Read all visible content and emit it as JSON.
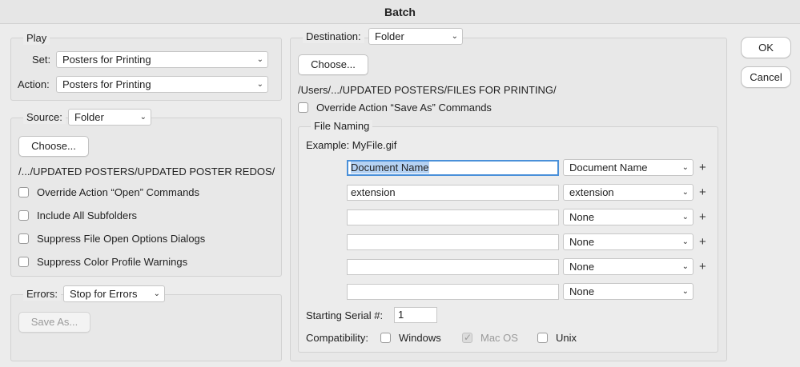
{
  "window": {
    "title": "Batch"
  },
  "play": {
    "legend": "Play",
    "set_label": "Set:",
    "set_value": "Posters for Printing",
    "action_label": "Action:",
    "action_value": "Posters for Printing"
  },
  "source": {
    "label": "Source:",
    "value": "Folder",
    "choose_label": "Choose...",
    "path": "/.../UPDATED POSTERS/UPDATED POSTER REDOS/",
    "options": [
      {
        "label": "Override Action “Open” Commands",
        "checked": false
      },
      {
        "label": "Include All Subfolders",
        "checked": false
      },
      {
        "label": "Suppress File Open Options Dialogs",
        "checked": false
      },
      {
        "label": "Suppress Color Profile Warnings",
        "checked": false
      }
    ]
  },
  "errors": {
    "label": "Errors:",
    "value": "Stop for Errors",
    "save_as_label": "Save As..."
  },
  "destination": {
    "label": "Destination:",
    "value": "Folder",
    "choose_label": "Choose...",
    "path": "/Users/.../UPDATED POSTERS/FILES FOR PRINTING/",
    "override_label": "Override Action “Save As” Commands",
    "override_checked": false
  },
  "file_naming": {
    "legend": "File Naming",
    "example": "Example: MyFile.gif",
    "rows": [
      {
        "text": "Document Name",
        "select": "Document Name",
        "plus": "+"
      },
      {
        "text": "extension",
        "select": "extension",
        "plus": "+"
      },
      {
        "text": "",
        "select": "None",
        "plus": "+"
      },
      {
        "text": "",
        "select": "None",
        "plus": "+"
      },
      {
        "text": "",
        "select": "None",
        "plus": "+"
      },
      {
        "text": "",
        "select": "None",
        "plus": ""
      }
    ],
    "serial_label": "Starting Serial #:",
    "serial_value": "1",
    "compat_label": "Compatibility:",
    "compat": [
      {
        "label": "Windows",
        "checked": false,
        "disabled": false
      },
      {
        "label": "Mac OS",
        "checked": true,
        "disabled": true
      },
      {
        "label": "Unix",
        "checked": false,
        "disabled": false
      }
    ]
  },
  "buttons": {
    "ok": "OK",
    "cancel": "Cancel"
  },
  "icons": {
    "chevron": "chevron-down-icon",
    "plus": "plus-icon",
    "check": "checkmark-icon"
  }
}
